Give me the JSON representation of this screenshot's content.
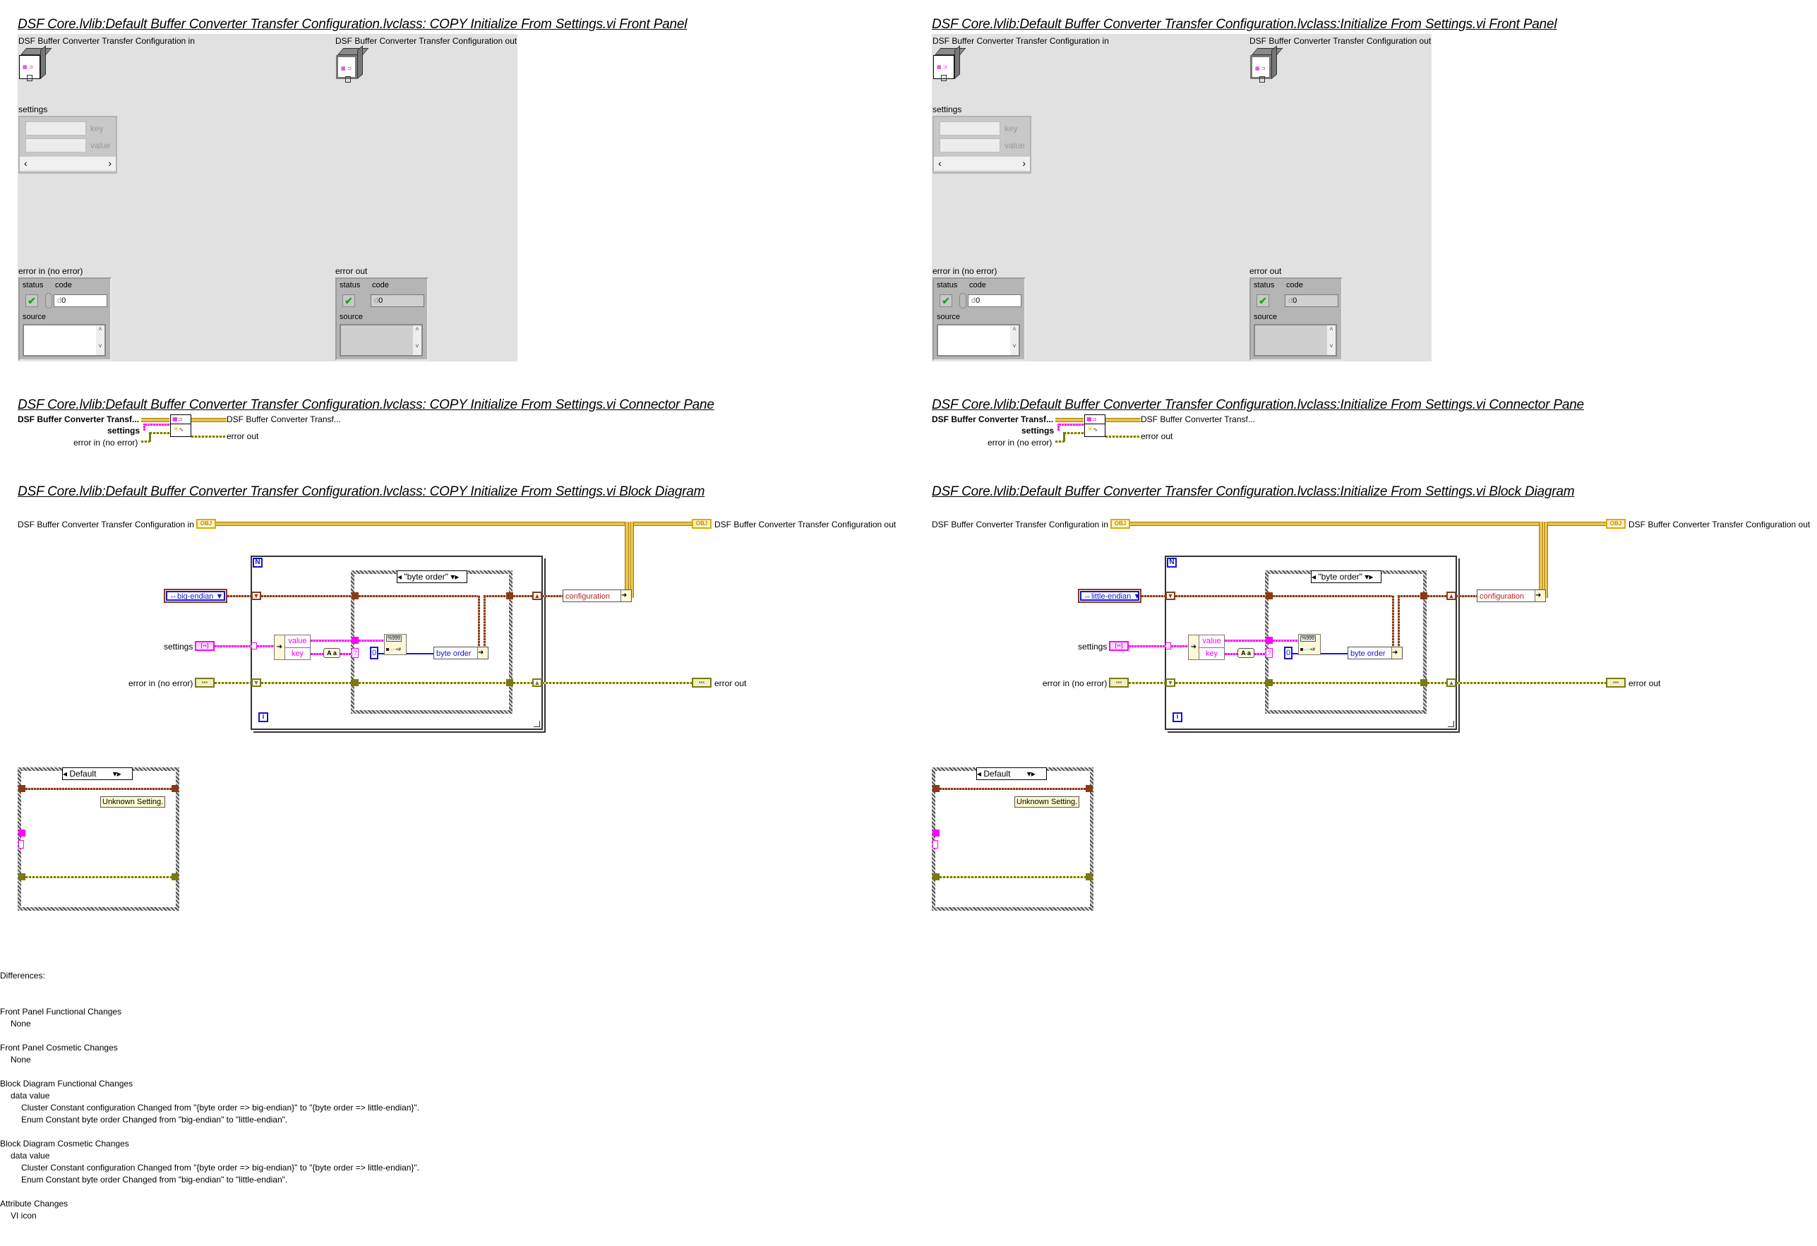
{
  "panels": [
    {
      "id": "copy",
      "front_panel_title": "DSF Core.lvlib:Default Buffer Converter Transfer Configuration.lvclass:  COPY  Initialize From Settings.vi Front Panel",
      "connector_pane_title": "DSF Core.lvlib:Default Buffer Converter Transfer Configuration.lvclass:  COPY  Initialize From Settings.vi Connector Pane",
      "block_diagram_title": "DSF Core.lvlib:Default Buffer Converter Transfer Configuration.lvclass:  COPY  Initialize From Settings.vi Block Diagram",
      "byte_order_constant": "big-endian"
    },
    {
      "id": "original",
      "front_panel_title": "DSF Core.lvlib:Default Buffer Converter Transfer Configuration.lvclass:Initialize From Settings.vi Front Panel",
      "connector_pane_title": "DSF Core.lvlib:Default Buffer Converter Transfer Configuration.lvclass:Initialize From Settings.vi Connector Pane",
      "block_diagram_title": "DSF Core.lvlib:Default Buffer Converter Transfer Configuration.lvclass:Initialize From Settings.vi Block Diagram",
      "byte_order_constant": "little-endian"
    }
  ],
  "front_panel": {
    "config_in_label": "DSF Buffer Converter Transfer Configuration in",
    "config_out_label": "DSF Buffer Converter Transfer Configuration out",
    "settings_label": "settings",
    "settings_key_label": "key",
    "settings_value_label": "value",
    "settings_scroll_left": "‹",
    "settings_scroll_right": "›",
    "error_in_label": "error in (no error)",
    "error_out_label": "error out",
    "status_label": "status",
    "code_label": "code",
    "source_label": "source",
    "status_check": "✔",
    "code_value": "0",
    "code_radix": "d",
    "scroll_up": "˄",
    "scroll_down": "˅"
  },
  "connector_pane": {
    "input_config": "DSF Buffer Converter Transf...",
    "input_settings": "settings",
    "input_error": "error in (no error)",
    "output_config": "DSF Buffer Converter Transf...",
    "output_error": "error out"
  },
  "block_diagram": {
    "config_in_label": "DSF Buffer Converter Transfer Configuration in",
    "config_out_label": "DSF Buffer Converter Transfer Configuration out",
    "obj_glyph": "OBJ",
    "settings_label": "settings",
    "error_in_label": "error in (no error)",
    "error_out_label": "error out",
    "loop_count_glyph": "N",
    "loop_index_glyph": "i",
    "unbundle_value": "value",
    "unbundle_key": "key",
    "to_lower_glyph": "A a",
    "case_selector": "\"byte order\"",
    "numeric_constant": "0",
    "scan_glyph": "%999",
    "bundle_byte_order": "byte order",
    "bundle_configuration": "configuration",
    "default_case_selector": "Default",
    "unknown_setting_note": "Unknown Setting."
  },
  "differences": {
    "heading": "Differences:",
    "sections": [
      {
        "title": "Front Panel Functional Changes",
        "lines": [
          "None"
        ]
      },
      {
        "title": "Front Panel Cosmetic Changes",
        "lines": [
          "None"
        ]
      },
      {
        "title": "Block Diagram Functional Changes",
        "subtitle": "data value",
        "lines": [
          "Cluster Constant configuration Changed from \"{byte order => big-endian}\" to \"{byte order => little-endian}\".",
          "Enum Constant byte order Changed from \"big-endian\" to \"little-endian\"."
        ]
      },
      {
        "title": "Block Diagram Cosmetic Changes",
        "subtitle": "data value",
        "lines": [
          "Cluster Constant configuration Changed from \"{byte order => big-endian}\" to \"{byte order => little-endian}\".",
          "Enum Constant byte order Changed from \"big-endian\" to \"little-endian\"."
        ]
      },
      {
        "title": "Attribute Changes",
        "lines": [
          "VI icon"
        ]
      }
    ]
  },
  "colors": {
    "panel_bg": "#e1e1e1",
    "class_wire": "#e8c34a",
    "enum_wire": "#8b3a16",
    "error_wire": "#7a7a10",
    "string_wire": "#ff00ff",
    "numeric_const": "#1515d0"
  }
}
